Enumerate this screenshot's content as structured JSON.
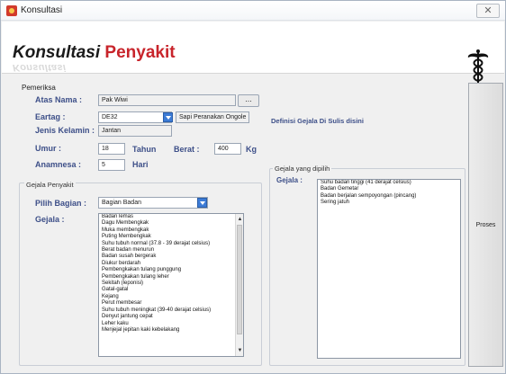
{
  "window": {
    "title": "Konsultasi",
    "close_glyph": "✕"
  },
  "header": {
    "brand_word1": "Konsultasi",
    "brand_word2": "Penyakit",
    "logo_icon": "caduceus-icon"
  },
  "pemeriksa": {
    "group_label": "Pemeriksa",
    "atas_nama_label": "Atas Nama :",
    "atas_nama_value": "Pak Wiwi",
    "browse_label": "...",
    "eartag_label": "Eartag :",
    "eartag_value": "DE32",
    "eartag_desc": "Sapi Peranakan Ongole",
    "jenis_kelamin_label": "Jenis Kelamin :",
    "jenis_kelamin_value": "Jantan",
    "umur_label": "Umur :",
    "umur_value": "18",
    "umur_unit": "Tahun",
    "berat_label": "Berat :",
    "berat_value": "400",
    "berat_unit": "Kg",
    "anamnesa_label": "Anamnesa :",
    "anamnesa_value": "5",
    "anamnesa_unit": "Hari"
  },
  "definisi_label": "Definisi Gejala Di Sulis disini",
  "gejala_penyakit": {
    "group_label": "Gejala Penyakit",
    "pilih_bagian_label": "Pilih Bagian :",
    "pilih_bagian_value": "Bagian Badan",
    "gejala_label": "Gejala :",
    "items": [
      "Badan lemas",
      "Dagu Membengkak",
      "Muka membengkak",
      "Puting Membengkak",
      "Suhu tubuh normal (37.8 - 39 derajat celsius)",
      "Berat badan menurun",
      "Badan susah bergerak",
      "Diukur berdarah",
      "Pembengkakan tulang punggung",
      "Pembengkakan tulang leher",
      "Sekitah (leponisi)",
      "Gatal-gatal",
      "Kejang",
      "Perut membesar",
      "Suhu tubuh meningkat (39-40 derajat celsius)",
      "Denyut jantung cepat",
      "Leher kaku",
      "Menjejal jepitan kaki kebelakang"
    ]
  },
  "gejala_dipilih": {
    "group_label": "Gejala yang dipilih",
    "gejala_label": "Gejala :",
    "items": [
      "Suhu badan tinggi (41 derajat celsius)",
      "Badan Gemetar",
      "Badan berjalan sempoyongan (pincang)",
      "Sering jatuh"
    ]
  },
  "proses_label": "Proses"
}
